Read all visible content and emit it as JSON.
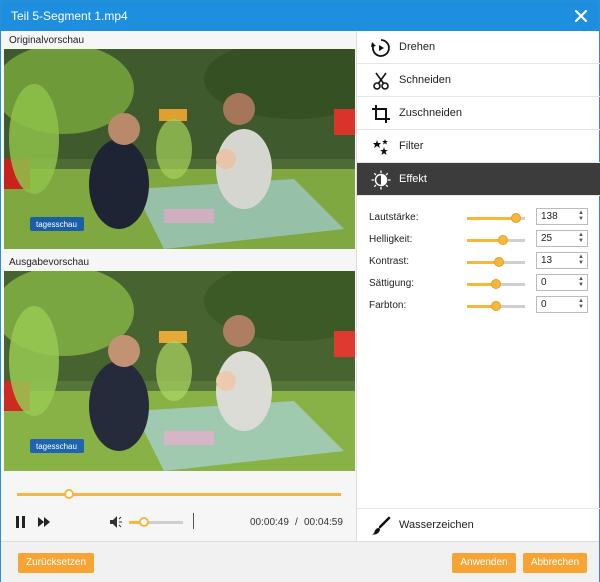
{
  "window": {
    "title": "Teil 5-Segment 1.mp4"
  },
  "preview": {
    "original_label": "Originalvorschau",
    "output_label": "Ausgabevorschau",
    "logo_text": "tagesschau"
  },
  "playback": {
    "progress": 0.16,
    "volume": 0.28,
    "current_time": "00:00:49",
    "separator": "/",
    "total_time": "00:04:59"
  },
  "menu": {
    "items": [
      {
        "label": "Drehen",
        "icon": "rotate-icon"
      },
      {
        "label": "Schneiden",
        "icon": "scissors-icon"
      },
      {
        "label": "Zuschneiden",
        "icon": "crop-icon"
      },
      {
        "label": "Filter",
        "icon": "filter-icon"
      },
      {
        "label": "Effekt",
        "icon": "effect-icon",
        "active": true
      }
    ],
    "watermark_label": "Wasserzeichen"
  },
  "effect_params": [
    {
      "label": "Lautstärke:",
      "value": "138",
      "fraction": 0.84
    },
    {
      "label": "Helligkeit:",
      "value": "25",
      "fraction": 0.62
    },
    {
      "label": "Kontrast:",
      "value": "13",
      "fraction": 0.56
    },
    {
      "label": "Sättigung:",
      "value": "0",
      "fraction": 0.5
    },
    {
      "label": "Farbton:",
      "value": "0",
      "fraction": 0.5
    }
  ],
  "buttons": {
    "reset": "Zurücksetzen",
    "apply": "Anwenden",
    "cancel": "Abbrechen"
  },
  "colors": {
    "accent": "#f6a534",
    "titlebar": "#1e8fde",
    "active_menu": "#3c3c3c"
  }
}
